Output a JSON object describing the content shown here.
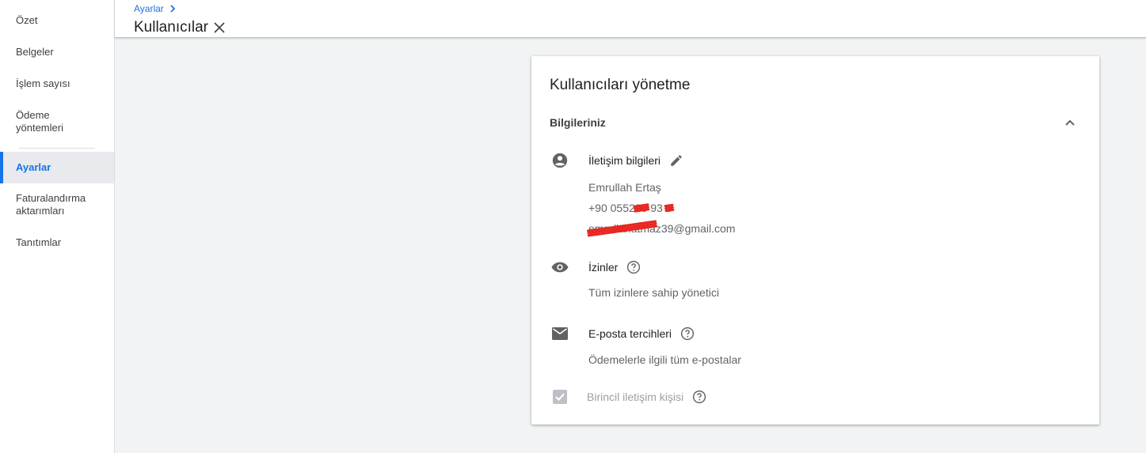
{
  "sidebar": {
    "items": [
      {
        "label": "Özet"
      },
      {
        "label": "Belgeler"
      },
      {
        "label": "İşlem sayısı"
      },
      {
        "label": "Ödeme\nyöntemleri"
      },
      {
        "label": "Ayarlar"
      },
      {
        "label": "Faturalandırma\naktarımları"
      },
      {
        "label": "Tanıtımlar"
      }
    ],
    "active_item": "Ayarlar"
  },
  "header": {
    "breadcrumb": "Ayarlar",
    "title": "Kullanıcılar"
  },
  "card": {
    "title": "Kullanıcıları yönetme",
    "section_title": "Bilgileriniz",
    "contact": {
      "label": "İletişim bilgileri",
      "name": "Emrullah Ertaş",
      "phone_prefix": "+90  0552",
      "phone_hidden_1": "00",
      "phone_mid": " 93 ",
      "phone_hidden_2": "9",
      "email_hidden": "emrullahatma",
      "email_hidden_2": "z39",
      "email_suffix": "@gmail.com"
    },
    "permissions": {
      "label": "İzinler",
      "value": "Tüm izinlere sahip yönetici"
    },
    "email_prefs": {
      "label": "E-posta tercihleri",
      "value": "Ödemelerle ilgili tüm e-postalar"
    },
    "primary_contact": {
      "label": "Birincil iletişim kişisi",
      "checked": true
    }
  },
  "colors": {
    "accent": "#1a73e8",
    "icon": "#5f6368",
    "redaction": "#e8251f"
  }
}
